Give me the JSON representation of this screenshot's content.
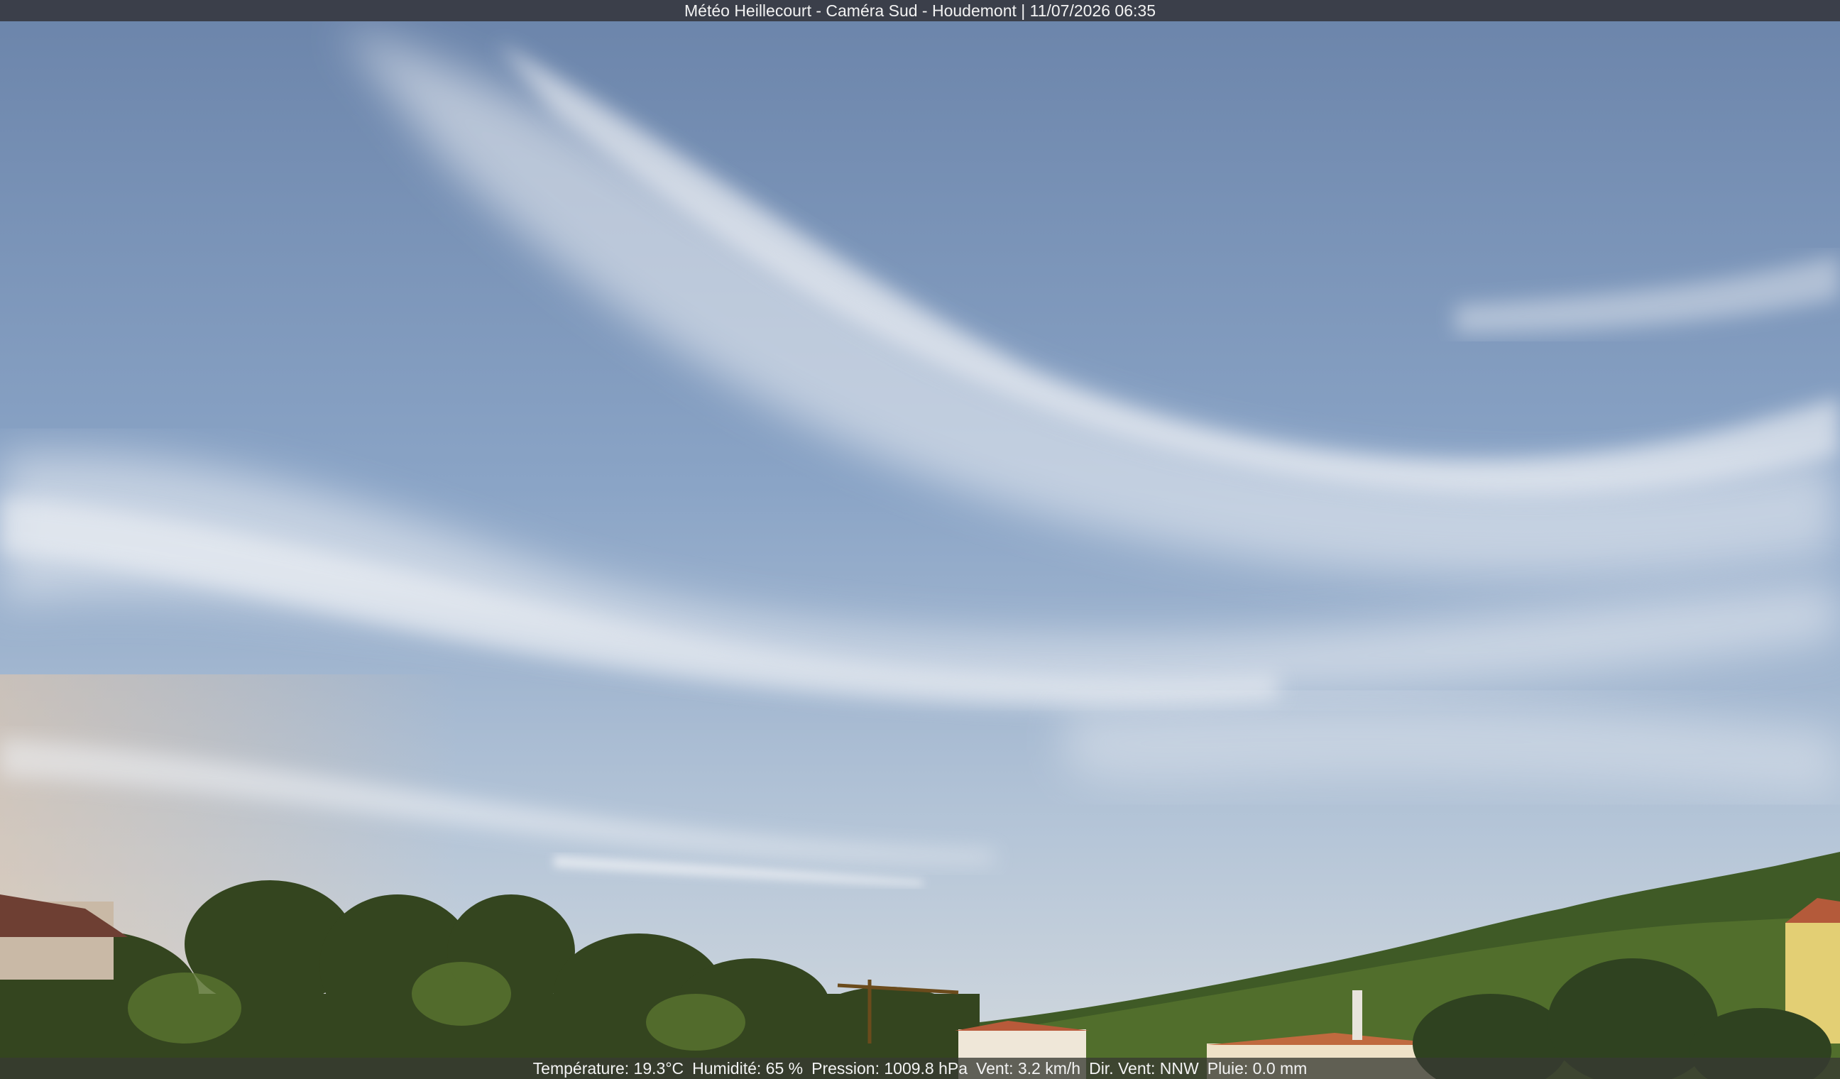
{
  "header": {
    "caption": "Météo Heillecourt - Caméra Sud - Houdemont | 11/07/2026 06:35"
  },
  "footer": {
    "temperature": "Température: 19.3°C",
    "humidity": "Humidité: 65 %",
    "pressure": "Pression: 1009.8 hPa",
    "wind": "Vent: 3.2 km/h",
    "wind_direction": "Dir. Vent: NNW",
    "rain": "Pluie: 0.0 mm"
  },
  "colors": {
    "sky_top": "#6d86ab",
    "sky_mid": "#8ea8c8",
    "sky_horizon": "#c9d3dc",
    "cloud": "#eef1f4",
    "trees_dark": "#2e3a1f",
    "trees_mid": "#4f6a2b",
    "house_yellow": "#e5d37a"
  }
}
